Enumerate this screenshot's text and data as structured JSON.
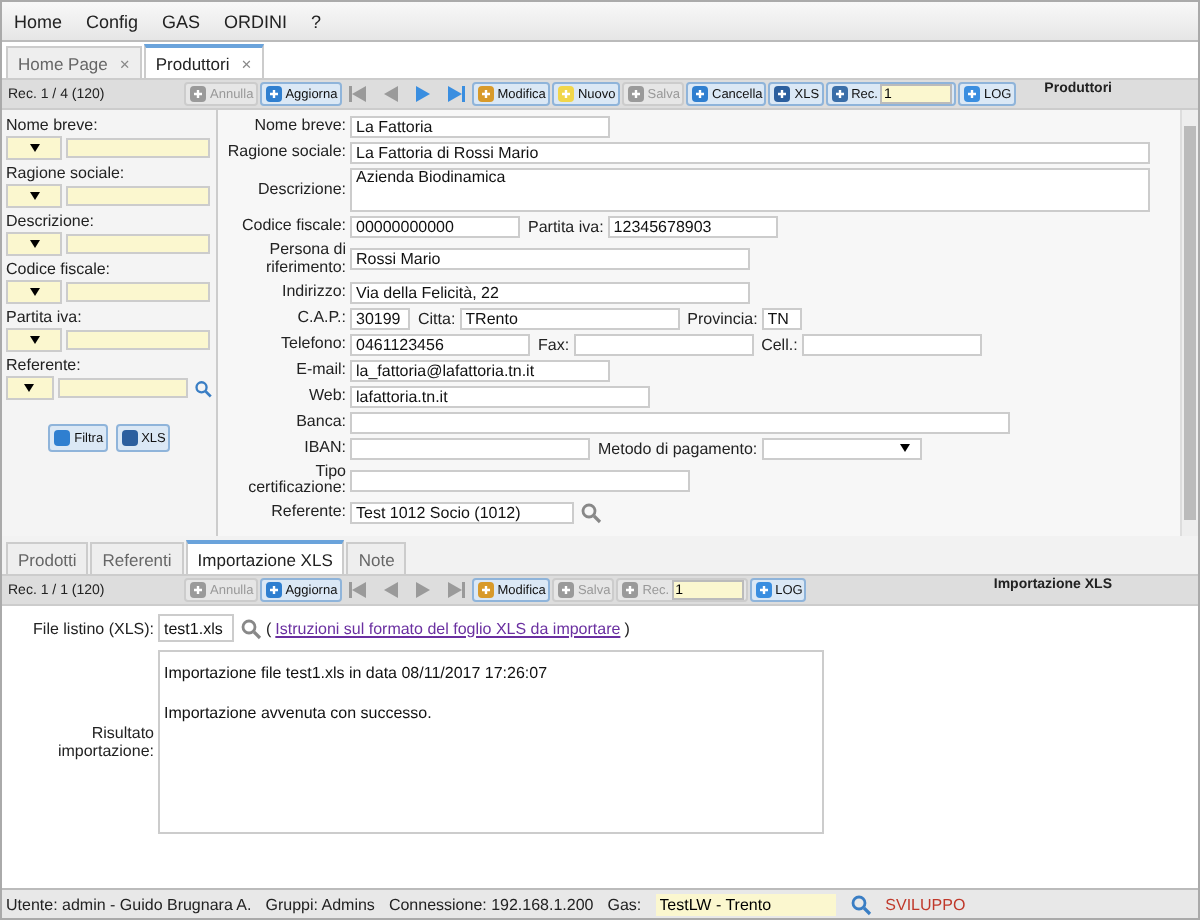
{
  "menu": [
    "Home",
    "Config",
    "GAS",
    "ORDINI",
    "?"
  ],
  "tabs": [
    {
      "label": "Home Page",
      "close": "×",
      "selected": false
    },
    {
      "label": "Produttori",
      "close": "×",
      "selected": true
    }
  ],
  "toolbar": {
    "record": "Rec. 1 / 4 (120)",
    "title": "Produttori",
    "buttons": [
      {
        "kind": "undo",
        "label": "Annulla",
        "disabled": true
      },
      {
        "kind": "refresh",
        "label": "Aggiorna",
        "disabled": false
      },
      {
        "kind": "first",
        "disabled": true
      },
      {
        "kind": "prev",
        "disabled": true
      },
      {
        "kind": "next",
        "disabled": false
      },
      {
        "kind": "last",
        "disabled": false
      },
      {
        "kind": "edit",
        "label": "Modifica",
        "disabled": false
      },
      {
        "kind": "new",
        "label": "Nuovo",
        "disabled": false
      },
      {
        "kind": "save",
        "label": "Salva",
        "disabled": true
      },
      {
        "kind": "delete",
        "label": "Cancella",
        "disabled": false
      },
      {
        "kind": "export",
        "label": "XLS",
        "disabled": false
      },
      {
        "kind": "record",
        "label": "Rec.",
        "value": "1",
        "disabled": false
      },
      {
        "kind": "log",
        "label": "LOG",
        "disabled": false
      }
    ]
  },
  "filters": {
    "items": [
      {
        "label": "Nome breve:",
        "lookup": false
      },
      {
        "label": "Ragione sociale:",
        "lookup": false
      },
      {
        "label": "Descrizione:",
        "lookup": false
      },
      {
        "label": "Codice fiscale:",
        "lookup": false
      },
      {
        "label": "Partita iva:",
        "lookup": false
      },
      {
        "label": "Referente:",
        "lookup": true
      }
    ],
    "buttons": [
      {
        "kind": "refresh",
        "label": "Filtra"
      },
      {
        "kind": "export",
        "label": "XLS"
      }
    ]
  },
  "form": {
    "rows": [
      {
        "fields": [
          {
            "label": "Nome breve:",
            "value": "La Fattoria",
            "kind": "text"
          }
        ]
      },
      {
        "fields": [
          {
            "label": "Ragione sociale:",
            "value": "La Fattoria di Rossi Mario",
            "kind": "text"
          }
        ]
      },
      {
        "fields": [
          {
            "label": "Descrizione:",
            "value": "Azienda Biodinamica",
            "kind": "textarea"
          }
        ]
      },
      {
        "fields": [
          {
            "label": "Codice fiscale:",
            "value": "00000000000",
            "kind": "text"
          },
          {
            "label": "Partita iva:",
            "value": "12345678903",
            "kind": "text"
          }
        ]
      },
      {
        "fields": [
          {
            "label": "Persona di riferimento:",
            "value": "Rossi Mario",
            "kind": "text"
          }
        ]
      },
      {
        "fields": [
          {
            "label": "Indirizzo:",
            "value": "Via della Felicità, 22",
            "kind": "text"
          }
        ]
      },
      {
        "fields": [
          {
            "label": "C.A.P.:",
            "value": "30199",
            "kind": "text"
          },
          {
            "label": "Citta:",
            "value": "TRento",
            "kind": "text"
          },
          {
            "label": "Provincia:",
            "value": "TN",
            "kind": "text"
          }
        ]
      },
      {
        "fields": [
          {
            "label": "Telefono:",
            "value": "0461123456",
            "kind": "text"
          },
          {
            "label": "Fax:",
            "kind": "text"
          },
          {
            "label": "Cell.:",
            "kind": "text"
          }
        ]
      },
      {
        "fields": [
          {
            "label": "E-mail:",
            "value": "la_fattoria@lafattoria.tn.it",
            "kind": "text"
          }
        ]
      },
      {
        "fields": [
          {
            "label": "Web:",
            "value": "lafattoria.tn.it",
            "kind": "text"
          }
        ]
      },
      {
        "fields": [
          {
            "label": "Banca:",
            "kind": "text"
          }
        ]
      },
      {
        "fields": [
          {
            "label": "IBAN:",
            "kind": "text"
          },
          {
            "label": "Metodo di pagamento:",
            "kind": "select"
          }
        ]
      },
      {
        "fields": [
          {
            "label": "Tipo certificazione:",
            "kind": "text"
          }
        ]
      },
      {
        "fields": [
          {
            "label": "Referente:",
            "value": "Test 1012 Socio (1012)",
            "kind": "lookup"
          }
        ]
      }
    ]
  },
  "subtabs": [
    {
      "label": "Prodotti",
      "selected": false
    },
    {
      "label": "Referenti",
      "selected": false
    },
    {
      "label": "Importazione XLS",
      "selected": true
    },
    {
      "label": "Note",
      "selected": false
    }
  ],
  "subtoolbar": {
    "record": "Rec. 1 / 1 (120)",
    "title": "Importazione XLS",
    "buttons": [
      {
        "kind": "undo",
        "label": "Annulla",
        "disabled": true
      },
      {
        "kind": "refresh",
        "label": "Aggiorna",
        "disabled": false
      },
      {
        "kind": "first",
        "disabled": true
      },
      {
        "kind": "prev",
        "disabled": true
      },
      {
        "kind": "next",
        "disabled": true
      },
      {
        "kind": "last",
        "disabled": true
      },
      {
        "kind": "edit",
        "label": "Modifica",
        "disabled": false
      },
      {
        "kind": "save",
        "label": "Salva",
        "disabled": true
      },
      {
        "kind": "record",
        "label": "Rec.",
        "value": "1",
        "disabled": true
      },
      {
        "kind": "log",
        "label": "LOG",
        "disabled": false
      }
    ]
  },
  "import": {
    "file_label": "File listino (XLS):",
    "file_value": "test1.xls",
    "paren_open": "(",
    "link": "Istruzioni sul formato del foglio XLS da importare",
    "paren_close": ")",
    "result_label": "Risultato importazione:",
    "result_lines": [
      "Importazione file test1.xls in data 08/11/2017 17:26:07",
      "Importazione avvenuta con successo."
    ]
  },
  "status_bar": {
    "user": "Utente: admin - Guido Brugnara A.",
    "groups": "Gruppi: Admins",
    "connection": "Connessione: 192.168.1.200",
    "gas_label": "Gas:",
    "gas_value": "TestLW - Trento",
    "env": "SVILUPPO"
  }
}
